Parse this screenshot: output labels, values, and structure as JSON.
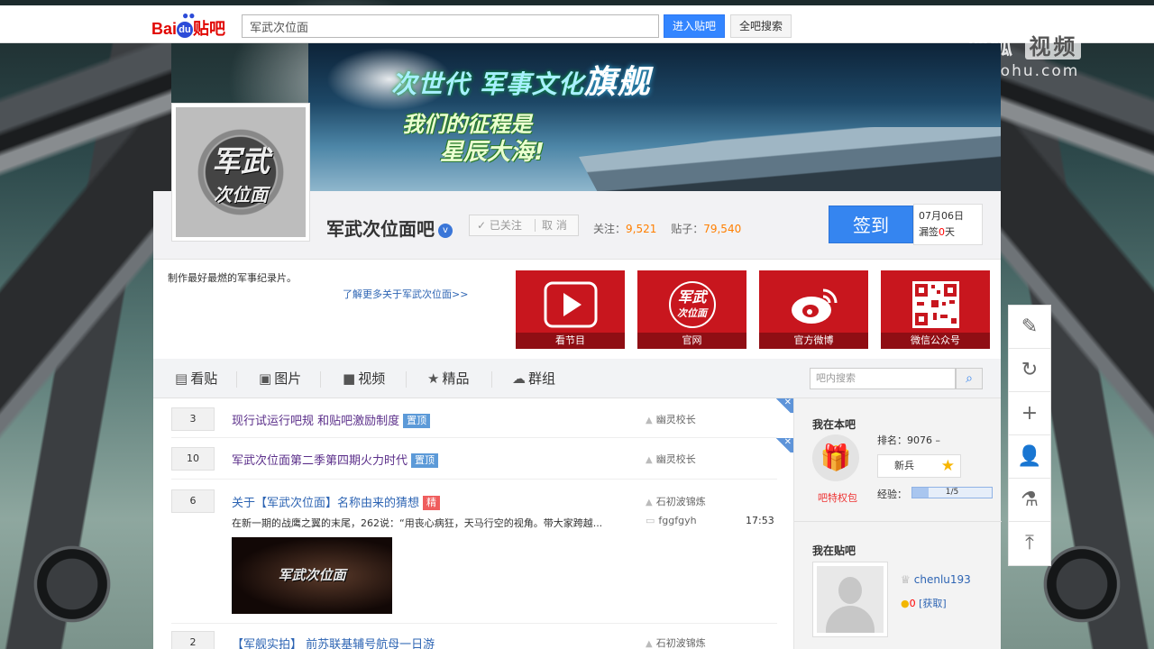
{
  "topbar": {
    "logo_text": "Bai",
    "logo_du": "du",
    "logo_tieba": "贴吧",
    "search_value": "军武次位面",
    "enter_button": "进入贴吧",
    "all_search_button": "全吧搜索"
  },
  "watermark": {
    "title_a": "搜狐",
    "title_b": "视频",
    "url": "tv.sohu.com"
  },
  "banner": {
    "slogan_a": "次世代 军事文化",
    "slogan_b": "旗舰",
    "slogan_line2": "我们的征程是",
    "slogan_line3": "星辰大海!"
  },
  "forum": {
    "avatar_line1": "军武",
    "avatar_line2": "次位面",
    "name": "军武次位面吧",
    "verified_icon": "v",
    "follow_label": "✓ 已关注",
    "unfollow_label": "取 消",
    "followers_label": "关注：",
    "followers_value": "9,521",
    "posts_label": "贴子：",
    "posts_value": "79,540",
    "sign_button": "签到",
    "sign_date": "07月06日",
    "missed_label": "漏签",
    "missed_value": "0",
    "missed_unit": "天",
    "intro": "制作最好最燃的军事纪录片。",
    "more_link": "了解更多关于军武次位面>>"
  },
  "tiles": [
    {
      "label": "看节目",
      "icon": "play-icon"
    },
    {
      "label": "官网",
      "icon": "site-logo-icon"
    },
    {
      "label": "官方微博",
      "icon": "weibo-icon"
    },
    {
      "label": "微信公众号",
      "icon": "qrcode-icon"
    }
  ],
  "tile_logo_text": "军武",
  "tile_logo_sub": "次位面",
  "nav": {
    "tabs": [
      {
        "label": "看贴",
        "icon": "post-icon"
      },
      {
        "label": "图片",
        "icon": "image-icon"
      },
      {
        "label": "视频",
        "icon": "video-icon"
      },
      {
        "label": "精品",
        "icon": "star-icon"
      },
      {
        "label": "群组",
        "icon": "chat-icon"
      }
    ],
    "search_placeholder": "吧内搜索"
  },
  "threads": [
    {
      "replies": "3",
      "title": "现行试运行吧规 和贴吧激励制度",
      "tag": "置顶",
      "author": "幽灵校长"
    },
    {
      "replies": "10",
      "title": "军武次位面第二季第四期火力时代",
      "tag": "置顶",
      "author": "幽灵校长"
    },
    {
      "replies": "6",
      "title": "关于【军武次位面】名称由来的猜想",
      "tag": "精",
      "author": "石初波锦炼",
      "abstract": "在新一期的战鹰之翼的末尾，262说：“用丧心病狂，天马行空的视角。带大家跨越...",
      "last_reply_user": "fggfgyh",
      "last_reply_time": "17:53",
      "thumb_text": "军武次位面"
    },
    {
      "replies": "2",
      "title": "【军舰实拍】 前苏联基辅号航母一日游",
      "author": "石初波锦炼"
    }
  ],
  "aside": {
    "in_forum_title": "我在本吧",
    "gift_label": "吧特权包",
    "rank_label": "排名：",
    "rank_value": "9076 –",
    "level_name": "新兵",
    "exp_label": "经验：",
    "exp_value": "1/5",
    "exp_fraction": 0.2,
    "in_tieba_title": "我在贴吧",
    "username": "chenlu193",
    "tbean_value": "0",
    "tbean_action": "[获取]"
  },
  "toolbar": [
    {
      "icon": "edit-icon",
      "glyph": "✎"
    },
    {
      "icon": "refresh-icon",
      "glyph": "↻"
    },
    {
      "icon": "plus-icon",
      "glyph": "+"
    },
    {
      "icon": "user-icon",
      "glyph": "👤"
    },
    {
      "icon": "flask-icon",
      "glyph": "⚗"
    },
    {
      "icon": "back-to-top-icon",
      "glyph": "⤒"
    }
  ],
  "colors": {
    "accent_blue": "#3585f0",
    "tile_red": "#c8161e",
    "followers_orange": "#ff7f00",
    "link_blue": "#2d64b3"
  }
}
